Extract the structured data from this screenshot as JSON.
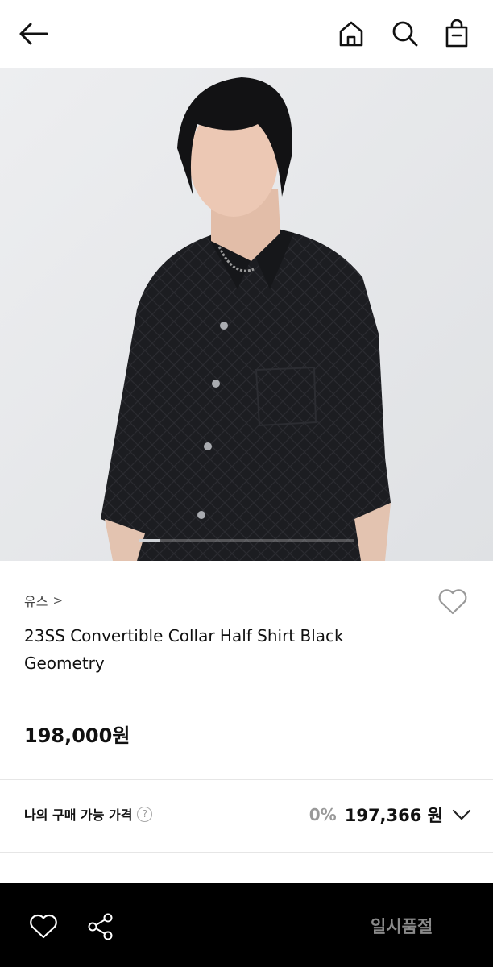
{
  "topbar": {
    "back_icon": "arrow-left-icon",
    "home_icon": "home-icon",
    "search_icon": "search-icon",
    "bag_icon": "shopping-bag-icon"
  },
  "gallery": {
    "image_progress": 0.1
  },
  "product": {
    "brand": "유스",
    "brand_chevron": ">",
    "title": "23SS Convertible Collar Half Shirt Black Geometry",
    "price": "198,000원",
    "wishlist_icon": "heart-outline-icon"
  },
  "my_price": {
    "label": "나의 구매 가능 가격",
    "help": "?",
    "discount": "0%",
    "price": "197,366 원",
    "expand_icon": "chevron-down-icon"
  },
  "bottom_bar": {
    "like_icon": "heart-outline-icon",
    "share_icon": "share-icon",
    "status_label": "일시품절"
  },
  "colors": {
    "accent_dark": "#000000",
    "muted_text": "#8a8a8a",
    "hero_bg": "#e9eaec"
  }
}
